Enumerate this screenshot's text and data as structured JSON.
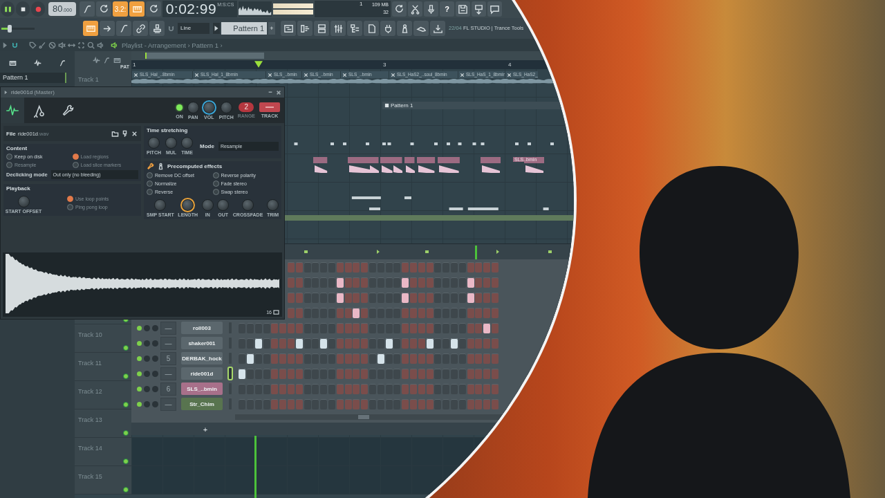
{
  "toolbar": {
    "tempo": "80",
    "tempo_decimals": ".000",
    "countdown": "3.2:",
    "time": "0:02:99",
    "time_label": "M:S:CS",
    "pattern_number": "1",
    "memory": "109 MB",
    "cpu": "32",
    "help": "?"
  },
  "toolbar2": {
    "volume": {
      "level": 0.25
    },
    "snap": "Line",
    "pattern": "Pattern 1",
    "pattern_add": "+",
    "hint_date": "22/04",
    "hint": "FL STUDIO | Trance Tools"
  },
  "breadcrumb": "Playlist - Arrangement › Pattern 1 ›",
  "browser": {
    "item": "Pattern 1"
  },
  "playlist": {
    "header_label": "PAT",
    "ruler": [
      "1",
      "3",
      "4"
    ],
    "clips": [
      "SLS_Hal_..8bmin",
      "SLS_Hal_1_8bmin",
      "SLS_..bmin",
      "SLS_..bmin",
      "SLS_..bmin",
      "SLS_HaS2_..soul_8bmin",
      "SLS_HaS_1_8bmin",
      "SLS_HaS2_"
    ],
    "pattern_clip": "Pattern 1",
    "sample_clip": "SLS..bmin",
    "tracks": [
      "Track 1",
      "Track 10",
      "Track 11",
      "Track 12",
      "Track 13",
      "Track 14",
      "Track 15"
    ]
  },
  "sampler": {
    "title": "ride001d",
    "subtitle": "(Master)",
    "tabs": [
      {
        "selected": true
      },
      {
        "selected": false
      },
      {
        "selected": false
      }
    ],
    "on": true,
    "on_label": "ON",
    "knobs": [
      {
        "label": "PAN",
        "active": false
      },
      {
        "label": "VOL",
        "active": true
      },
      {
        "label": "PITCH",
        "active": false
      }
    ],
    "range_value": "2",
    "range_label": "RANGE",
    "track_label": "TRACK",
    "file_label": "File",
    "file_name": "ride001d",
    "file_ext": ".wav",
    "content_title": "Content",
    "content_options": [
      {
        "label": "Keep on disk",
        "checked": false,
        "disabled": false
      },
      {
        "label": "Load regions",
        "checked": true,
        "disabled": true
      },
      {
        "label": "Resample",
        "checked": false,
        "disabled": true
      },
      {
        "label": "Load slice markers",
        "checked": false,
        "disabled": true
      }
    ],
    "declick_label": "Declicking mode",
    "declick_value": "Out only (no bleeding)",
    "playback_title": "Playback",
    "start_offset": "START OFFSET",
    "playback_options": [
      {
        "label": "Use loop points",
        "checked": true,
        "disabled": true
      },
      {
        "label": "Ping pong loop",
        "checked": false,
        "disabled": true
      }
    ],
    "stretch_title": "Time stretching",
    "stretch_knobs": [
      "PITCH",
      "MUL",
      "TIME"
    ],
    "mode_label": "Mode",
    "mode_value": "Resample",
    "effects_title": "Precomputed effects",
    "effects": [
      {
        "label": "Remove DC offset",
        "checked": false,
        "disabled": false
      },
      {
        "label": "Reverse polarity",
        "checked": false,
        "disabled": false
      },
      {
        "label": "Normalize",
        "checked": false,
        "disabled": false
      },
      {
        "label": "Fade stereo",
        "checked": false,
        "disabled": false
      },
      {
        "label": "Reverse",
        "checked": false,
        "disabled": false
      },
      {
        "label": "Swap stereo",
        "checked": false,
        "disabled": false
      }
    ],
    "effect_knobs": [
      {
        "label": "SMP START",
        "active": false
      },
      {
        "label": "LENGTH",
        "active": true
      },
      {
        "label": "IN",
        "active": false
      },
      {
        "label": "OUT",
        "active": false
      },
      {
        "label": "CROSSFADE",
        "active": false
      },
      {
        "label": "TRIM",
        "active": false
      }
    ],
    "zoom_value": "16"
  },
  "rack": {
    "add": "+",
    "rows": [
      {
        "steps": [
          false,
          false,
          false,
          false,
          false,
          false,
          false,
          false,
          false,
          false,
          false,
          false,
          false,
          false,
          false,
          false,
          false,
          false,
          false,
          false,
          false,
          false,
          false,
          false,
          false,
          false
        ]
      },
      {
        "steps": [
          false,
          false,
          false,
          false,
          false,
          false,
          true,
          false,
          false,
          false,
          false,
          false,
          false,
          false,
          true,
          false,
          false,
          false,
          false,
          false,
          false,
          false,
          true,
          false,
          false,
          false
        ]
      },
      {
        "steps": [
          false,
          false,
          false,
          false,
          false,
          false,
          true,
          false,
          false,
          false,
          false,
          false,
          false,
          false,
          true,
          false,
          false,
          false,
          false,
          false,
          false,
          false,
          true,
          false,
          false,
          false
        ]
      },
      {
        "steps": [
          false,
          false,
          false,
          false,
          false,
          false,
          false,
          false,
          true,
          false,
          false,
          false,
          false,
          false,
          false,
          false,
          false,
          false,
          false,
          false,
          false,
          false,
          false,
          false,
          false,
          false
        ]
      },
      {
        "name": "roll003",
        "number": "—",
        "color": "#5b676d",
        "selected": false,
        "steps": [
          false,
          false,
          false,
          false,
          false,
          false,
          false,
          false,
          false,
          false,
          false,
          false,
          false,
          false,
          false,
          false,
          false,
          false,
          false,
          false,
          false,
          false,
          false,
          false,
          false,
          false,
          false,
          false,
          false,
          false,
          true,
          false
        ]
      },
      {
        "name": "shaker001",
        "number": "—",
        "color": "#5b676d",
        "selected": false,
        "steps": [
          false,
          false,
          true,
          false,
          false,
          false,
          false,
          true,
          false,
          false,
          true,
          false,
          false,
          false,
          false,
          false,
          false,
          false,
          true,
          false,
          false,
          false,
          false,
          true,
          false,
          false,
          true,
          false,
          false,
          false,
          false,
          false
        ]
      },
      {
        "name": "DERBAK_hock",
        "number": "5",
        "color": "#5b676d",
        "selected": false,
        "steps": [
          false,
          true,
          false,
          false,
          false,
          false,
          false,
          false,
          false,
          false,
          false,
          false,
          false,
          false,
          false,
          false,
          false,
          true,
          false,
          false,
          false,
          false,
          false,
          false,
          false,
          false,
          false,
          false,
          false,
          false,
          false,
          false
        ]
      },
      {
        "name": "ride001d",
        "number": "—",
        "color": "#5b676d",
        "selected": true,
        "steps": [
          true,
          false,
          false,
          false,
          false,
          false,
          false,
          false,
          false,
          false,
          false,
          false,
          false,
          false,
          false,
          false,
          false,
          false,
          false,
          false,
          false,
          false,
          false,
          false,
          false,
          false,
          false,
          false,
          false,
          false,
          false,
          false
        ]
      },
      {
        "name": "SLS_..bmin",
        "number": "6",
        "color": "#a8708a",
        "selected": false,
        "steps": [
          false,
          false,
          false,
          false,
          false,
          false,
          false,
          false,
          false,
          false,
          false,
          false,
          false,
          false,
          false,
          false,
          false,
          false,
          false,
          false,
          false,
          false,
          false,
          false,
          false,
          false,
          false,
          false,
          false,
          false,
          false,
          false
        ]
      },
      {
        "name": "Str_Chim",
        "number": "—",
        "color": "#58744f",
        "selected": false,
        "steps": [
          false,
          false,
          false,
          false,
          false,
          false,
          false,
          false,
          false,
          false,
          false,
          false,
          false,
          false,
          false,
          false,
          false,
          false,
          false,
          false,
          false,
          false,
          false,
          false,
          false,
          false,
          false,
          false,
          false,
          false,
          false,
          false
        ]
      }
    ]
  }
}
